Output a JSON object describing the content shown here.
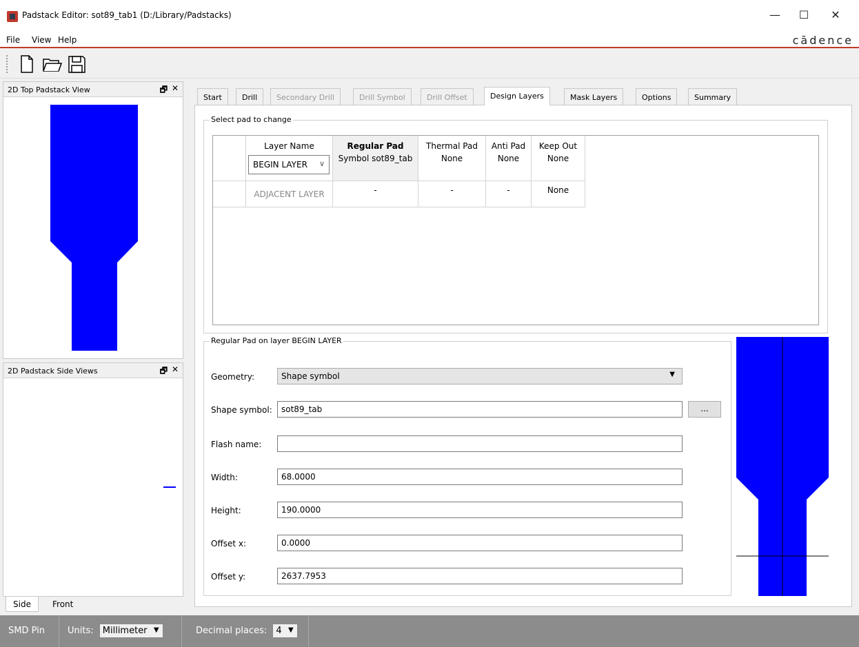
{
  "window": {
    "title": "Padstack Editor: sot89_tab1  (D:/Library/Padstacks)",
    "minimize": "—",
    "maximize": "☐",
    "close": "✕"
  },
  "menu": {
    "file": "File",
    "view": "View",
    "help": "Help",
    "logo": "cādence"
  },
  "toolbar": {
    "icons": [
      "new-file-icon",
      "open-folder-icon",
      "save-icon"
    ]
  },
  "docks": {
    "top_view": {
      "title": "2D Top Padstack View",
      "float": "🗗",
      "close": "✕"
    },
    "side_view": {
      "title": "2D Padstack Side Views",
      "float": "🗗",
      "close": "✕"
    },
    "bottom_tabs": [
      "Side",
      "Front"
    ]
  },
  "tabs": [
    {
      "label": "Start",
      "state": "normal"
    },
    {
      "label": "Drill",
      "state": "normal"
    },
    {
      "label": "Secondary Drill",
      "state": "disabled"
    },
    {
      "label": "Drill Symbol",
      "state": "disabled"
    },
    {
      "label": "Drill Offset",
      "state": "disabled"
    },
    {
      "label": "Design Layers",
      "state": "active"
    },
    {
      "label": "Mask Layers",
      "state": "normal"
    },
    {
      "label": "Options",
      "state": "normal"
    },
    {
      "label": "Summary",
      "state": "normal"
    }
  ],
  "select_pad": {
    "group_title": "Select pad to change",
    "headers": {
      "layer_name": "Layer Name",
      "regular_pad": "Regular Pad",
      "thermal_pad": "Thermal Pad",
      "anti_pad": "Anti Pad",
      "keep_out": "Keep Out"
    },
    "rows": [
      {
        "layer": "BEGIN LAYER",
        "regular": "Symbol sot89_tab",
        "thermal": "None",
        "anti": "None",
        "keep_out": "None"
      },
      {
        "layer": "ADJACENT LAYER",
        "regular": "-",
        "thermal": "-",
        "anti": "-",
        "keep_out": "None"
      }
    ]
  },
  "regular_pad": {
    "group_title": "Regular Pad on layer BEGIN LAYER",
    "geometry_label": "Geometry:",
    "geometry_value": "Shape symbol",
    "shape_symbol_label": "Shape symbol:",
    "shape_symbol_value": "sot89_tab",
    "browse_label": "...",
    "flash_name_label": "Flash name:",
    "flash_name_value": "",
    "width_label": "Width:",
    "width_value": "68.0000",
    "height_label": "Height:",
    "height_value": "190.0000",
    "offset_x_label": "Offset x:",
    "offset_x_value": "0.0000",
    "offset_y_label": "Offset y:",
    "offset_y_value": "2637.7953"
  },
  "statusbar": {
    "pin_type": "SMD Pin",
    "units_label": "Units:",
    "units_value": "Millimeter",
    "decimal_label": "Decimal places:",
    "decimal_value": "4"
  },
  "colors": {
    "pad": "#0000ff",
    "accent": "#c0392b"
  }
}
